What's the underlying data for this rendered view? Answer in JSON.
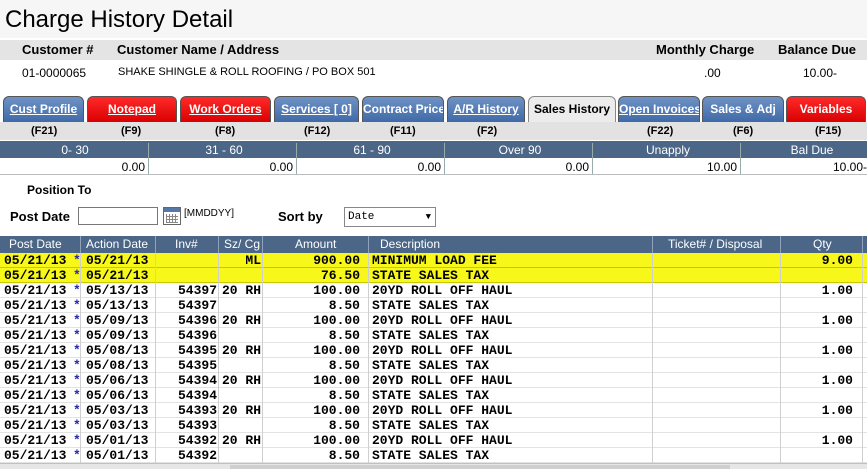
{
  "title": "Charge History Detail",
  "customer": {
    "headers": {
      "number": "Customer #",
      "name_address": "Customer Name / Address",
      "monthly_charge": "Monthly Charge",
      "balance_due": "Balance Due"
    },
    "number": "01-0000065",
    "name_address": "SHAKE SHINGLE & ROLL ROOFING  /  PO BOX 501",
    "monthly_charge": ".00",
    "balance_due": "10.00-"
  },
  "tabs": [
    {
      "label": "Cust Profile",
      "fkey": "(F21)",
      "color": "blue"
    },
    {
      "label": "Notepad",
      "fkey": "(F9)",
      "color": "red"
    },
    {
      "label": "Work Orders",
      "fkey": "(F8)",
      "color": "red"
    },
    {
      "label": "Services [    0]",
      "fkey": "(F12)",
      "color": "blue"
    },
    {
      "label": "Contract Price",
      "fkey": "(F11)",
      "color": "blue"
    },
    {
      "label": "A/R History",
      "fkey": "(F2)",
      "color": "blue"
    },
    {
      "label": "Sales History",
      "fkey": "",
      "color": "active"
    },
    {
      "label": "Open Invoices",
      "fkey": "(F22)",
      "color": "blue"
    },
    {
      "label": "Sales & Adj",
      "fkey": "(F6)",
      "color": "blue"
    },
    {
      "label": "Variables",
      "fkey": "(F15)",
      "color": "red"
    }
  ],
  "aging": {
    "headers": [
      "0- 30",
      "31 - 60",
      "61 - 90",
      "Over 90",
      "Unapply",
      "Bal Due"
    ],
    "values": [
      "0.00",
      "0.00",
      "0.00",
      "0.00",
      "10.00",
      "10.00-"
    ]
  },
  "position": {
    "label": "Position To",
    "post_date_label": "Post Date",
    "post_date_value": "",
    "date_format": "[MMDDYY]",
    "sort_label": "Sort by",
    "sort_value": "Date"
  },
  "grid": {
    "columns": [
      "Post Date",
      "Action Date",
      "Inv#",
      "Sz/ Cg",
      "Amount",
      "Description",
      "Ticket# / Disposal",
      "Qty"
    ],
    "rows": [
      {
        "post": "05/21/13",
        "mark": "*",
        "action": "05/21/13",
        "inv": "",
        "szcg": "ML",
        "amount": "900.00",
        "desc": "MINIMUM LOAD FEE",
        "ticket": "",
        "qty": "9.00",
        "highlight": true
      },
      {
        "post": "05/21/13",
        "mark": "*",
        "action": "05/21/13",
        "inv": "",
        "szcg": "",
        "amount": "76.50",
        "desc": "STATE SALES TAX",
        "ticket": "",
        "qty": "",
        "highlight": true
      },
      {
        "post": "05/21/13",
        "mark": "*",
        "action": "05/13/13",
        "inv": "54397",
        "szcg": "20 RH",
        "amount": "100.00",
        "desc": "20YD ROLL OFF HAUL",
        "ticket": "",
        "qty": "1.00",
        "highlight": false
      },
      {
        "post": "05/21/13",
        "mark": "*",
        "action": "05/13/13",
        "inv": "54397",
        "szcg": "",
        "amount": "8.50",
        "desc": "STATE SALES TAX",
        "ticket": "",
        "qty": "",
        "highlight": false
      },
      {
        "post": "05/21/13",
        "mark": "*",
        "action": "05/09/13",
        "inv": "54396",
        "szcg": "20 RH",
        "amount": "100.00",
        "desc": "20YD ROLL OFF HAUL",
        "ticket": "",
        "qty": "1.00",
        "highlight": false
      },
      {
        "post": "05/21/13",
        "mark": "*",
        "action": "05/09/13",
        "inv": "54396",
        "szcg": "",
        "amount": "8.50",
        "desc": "STATE SALES TAX",
        "ticket": "",
        "qty": "",
        "highlight": false
      },
      {
        "post": "05/21/13",
        "mark": "*",
        "action": "05/08/13",
        "inv": "54395",
        "szcg": "20 RH",
        "amount": "100.00",
        "desc": "20YD ROLL OFF HAUL",
        "ticket": "",
        "qty": "1.00",
        "highlight": false
      },
      {
        "post": "05/21/13",
        "mark": "*",
        "action": "05/08/13",
        "inv": "54395",
        "szcg": "",
        "amount": "8.50",
        "desc": "STATE SALES TAX",
        "ticket": "",
        "qty": "",
        "highlight": false
      },
      {
        "post": "05/21/13",
        "mark": "*",
        "action": "05/06/13",
        "inv": "54394",
        "szcg": "20 RH",
        "amount": "100.00",
        "desc": "20YD ROLL OFF HAUL",
        "ticket": "",
        "qty": "1.00",
        "highlight": false
      },
      {
        "post": "05/21/13",
        "mark": "*",
        "action": "05/06/13",
        "inv": "54394",
        "szcg": "",
        "amount": "8.50",
        "desc": "STATE SALES TAX",
        "ticket": "",
        "qty": "",
        "highlight": false
      },
      {
        "post": "05/21/13",
        "mark": "*",
        "action": "05/03/13",
        "inv": "54393",
        "szcg": "20 RH",
        "amount": "100.00",
        "desc": "20YD ROLL OFF HAUL",
        "ticket": "",
        "qty": "1.00",
        "highlight": false
      },
      {
        "post": "05/21/13",
        "mark": "*",
        "action": "05/03/13",
        "inv": "54393",
        "szcg": "",
        "amount": "8.50",
        "desc": "STATE SALES TAX",
        "ticket": "",
        "qty": "",
        "highlight": false
      },
      {
        "post": "05/21/13",
        "mark": "*",
        "action": "05/01/13",
        "inv": "54392",
        "szcg": "20 RH",
        "amount": "100.00",
        "desc": "20YD ROLL OFF HAUL",
        "ticket": "",
        "qty": "1.00",
        "highlight": false
      },
      {
        "post": "05/21/13",
        "mark": "*",
        "action": "05/01/13",
        "inv": "54392",
        "szcg": "",
        "amount": "8.50",
        "desc": "STATE SALES TAX",
        "ticket": "",
        "qty": "",
        "highlight": false
      }
    ]
  },
  "colors": {
    "header_bar": "#4b6686",
    "highlight_row": "#f7f71a",
    "tab_blue": "#3f6aa8",
    "tab_red": "#d90000"
  }
}
